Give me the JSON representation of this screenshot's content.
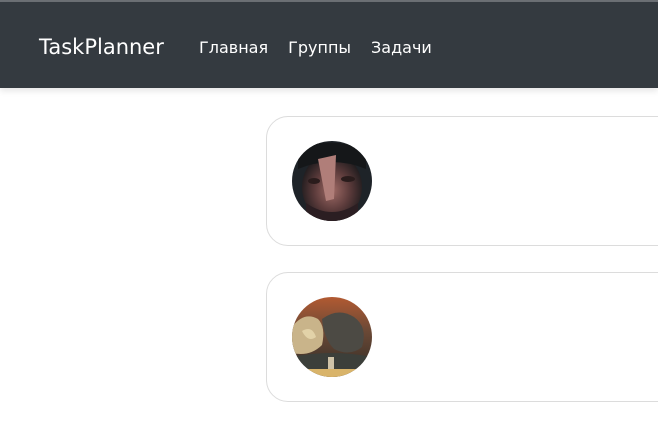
{
  "navbar": {
    "brand": "TaskPlanner",
    "links": [
      {
        "label": "Главная"
      },
      {
        "label": "Группы"
      },
      {
        "label": "Задачи"
      }
    ]
  },
  "groups": [
    {
      "avatar": "user-photo"
    },
    {
      "avatar": "painting-photo"
    }
  ]
}
